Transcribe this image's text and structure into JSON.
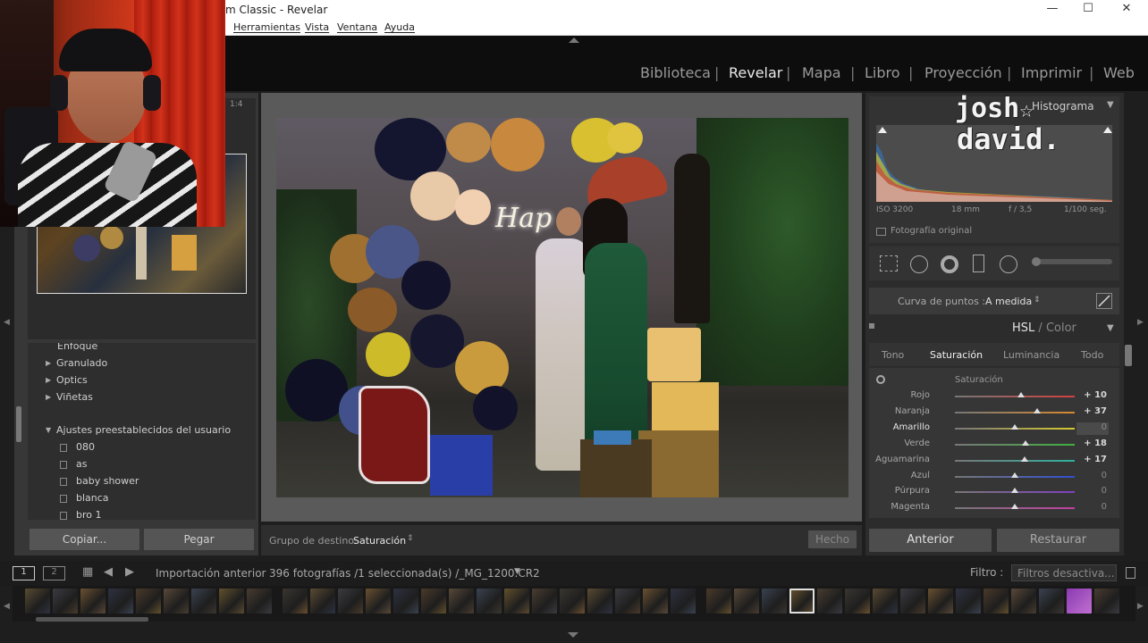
{
  "window": {
    "title": "m Classic - Revelar",
    "minimize": "—",
    "maximize": "☐",
    "close": "✕"
  },
  "menu": [
    "Herramientas",
    "Vista",
    "Ventana",
    "Ayuda"
  ],
  "modules": {
    "items": [
      "Biblioteca",
      "Revelar",
      "Mapa",
      "Libro",
      "Proyección",
      "Imprimir",
      "Web"
    ],
    "active": "Revelar",
    "separator": "|"
  },
  "navigator": {
    "zoom": "1:4"
  },
  "left_panel": {
    "items": [
      "Enfoque",
      "Granulado",
      "Optics",
      "Viñetas"
    ],
    "presets_header": "Ajustes preestablecidos del usuario",
    "presets": [
      "080",
      "as",
      "baby shower",
      "blanca",
      "bro 1"
    ],
    "copy_button": "Copiar...",
    "paste_button": "Pegar"
  },
  "toolbar": {
    "target_label": "Grupo de destino:",
    "target_value": "Saturación",
    "done_button": "Hecho"
  },
  "histogram": {
    "title": "Histograma",
    "iso": "ISO 3200",
    "focal": "18 mm",
    "aperture": "f / 3,5",
    "shutter": "1/100 seg.",
    "original_photo": "Fotografía original"
  },
  "watermark": {
    "line1": "josh",
    "line2": "david.",
    "star": "☆"
  },
  "tone_curve": {
    "label": "Curva de puntos :",
    "value": "A medida"
  },
  "hsl": {
    "title_hsl": "HSL",
    "title_sep": "/",
    "title_color": "Color",
    "tabs": [
      "Tono",
      "Saturación",
      "Luminancia",
      "Todo"
    ],
    "active_tab": "Saturación",
    "group_label": "Saturación",
    "rows": [
      {
        "label": "Rojo",
        "value": "+ 10",
        "amount": 10,
        "color": "#d24040"
      },
      {
        "label": "Naranja",
        "value": "+ 37",
        "amount": 37,
        "color": "#d68a30"
      },
      {
        "label": "Amarillo",
        "value": "0",
        "amount": 0,
        "color": "#d6c830"
      },
      {
        "label": "Verde",
        "value": "+ 18",
        "amount": 18,
        "color": "#40b040"
      },
      {
        "label": "Aguamarina",
        "value": "+ 17",
        "amount": 17,
        "color": "#30b0a0"
      },
      {
        "label": "Azul",
        "value": "0",
        "amount": 0,
        "color": "#3050d0"
      },
      {
        "label": "Púrpura",
        "value": "0",
        "amount": 0,
        "color": "#8040c0"
      },
      {
        "label": "Magenta",
        "value": "0",
        "amount": 0,
        "color": "#c040a0"
      }
    ]
  },
  "right_buttons": {
    "previous": "Anterior",
    "reset": "Restaurar"
  },
  "filmstrip": {
    "source": "Importación anterior",
    "info": "396 fotografías /1 seleccionada(s) /_MG_1200.CR2",
    "filter_label": "Filtro :",
    "filter_value": "Filtros desactiva..."
  },
  "photo": {
    "sign": "Hap"
  },
  "colors": {
    "accent": "#e8e8e8",
    "panel": "#383838",
    "background": "#1e1e1e"
  }
}
